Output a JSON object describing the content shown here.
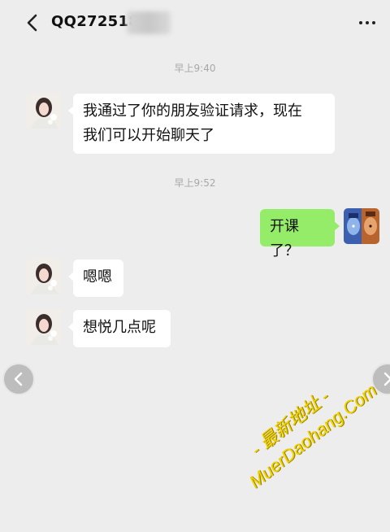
{
  "header": {
    "title": "QQ272518",
    "back_icon": "chevron-left-icon",
    "more_icon": "more-dots-icon"
  },
  "messages": [
    {
      "type": "timestamp",
      "text": "早上9:40"
    },
    {
      "type": "incoming",
      "line1": "我通过了你的朋友验证请求，现在",
      "line2": "我们可以开始聊天了"
    },
    {
      "type": "timestamp",
      "text": "早上9:52"
    },
    {
      "type": "outgoing",
      "text": "开课了？"
    },
    {
      "type": "incoming",
      "text": "嗯嗯"
    },
    {
      "type": "incoming",
      "text": "想悦几点呢"
    }
  ],
  "navigation": {
    "prev_icon": "chevron-left-icon",
    "next_icon": "chevron-right-icon"
  },
  "watermark": {
    "line1": "- 最新地址 -",
    "line2": "MuerDaohang.Com"
  },
  "colors": {
    "background": "#ededed",
    "incoming_bubble": "#ffffff",
    "outgoing_bubble": "#95ec69",
    "timestamp_text": "#a8a8a8",
    "watermark": "#f2d300"
  }
}
